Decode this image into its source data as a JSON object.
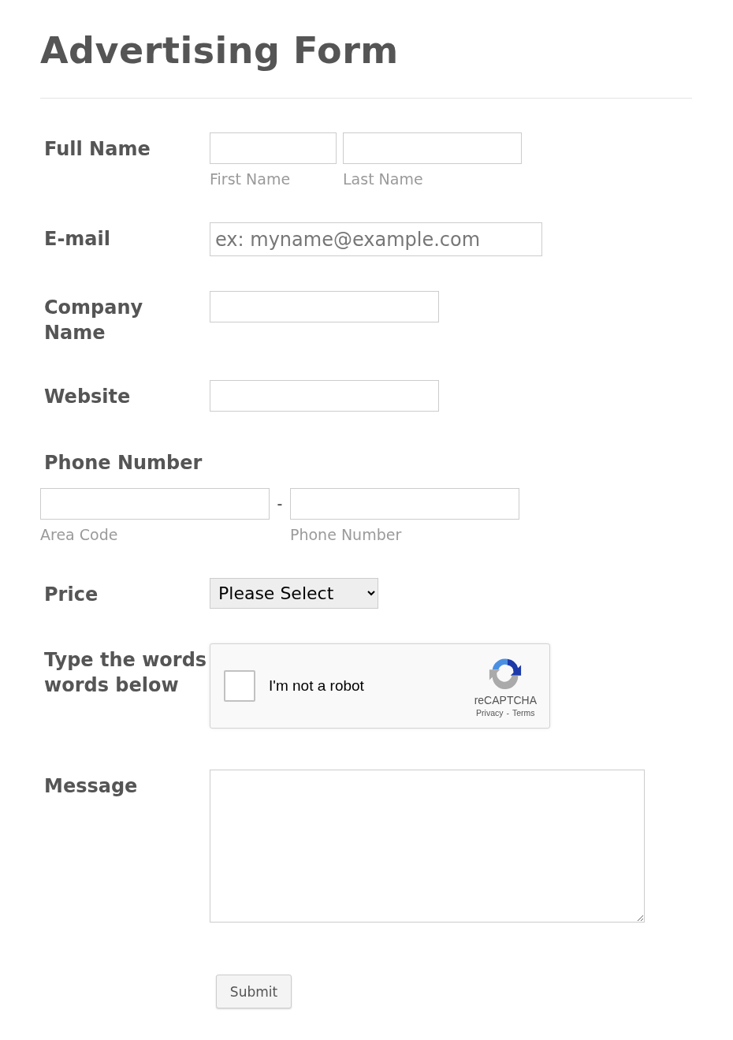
{
  "title": "Advertising Form",
  "fields": [
    {
      "kind": "name",
      "label": "Full Name",
      "inputs": [
        {
          "sublabel": "First Name"
        },
        {
          "sublabel": "Last Name"
        }
      ]
    },
    {
      "kind": "text",
      "label": "E-mail",
      "placeholder": "ex: myname@example.com"
    },
    {
      "kind": "text",
      "label": "Company Name"
    },
    {
      "kind": "text",
      "label": "Website"
    },
    {
      "kind": "phone",
      "label": "Phone Number",
      "separator": "-",
      "inputs": [
        {
          "sublabel": "Area Code"
        },
        {
          "sublabel": "Phone Number"
        }
      ]
    },
    {
      "kind": "select",
      "label": "Price",
      "value": "Please Select"
    },
    {
      "kind": "captcha",
      "label": "Type the words words below",
      "checkbox_label": "I'm not a robot",
      "checked": false,
      "brand": "reCAPTCHA",
      "links": [
        "Privacy",
        "Terms"
      ],
      "separator": "-"
    },
    {
      "kind": "textarea",
      "label": "Message"
    }
  ],
  "submit": "Submit"
}
